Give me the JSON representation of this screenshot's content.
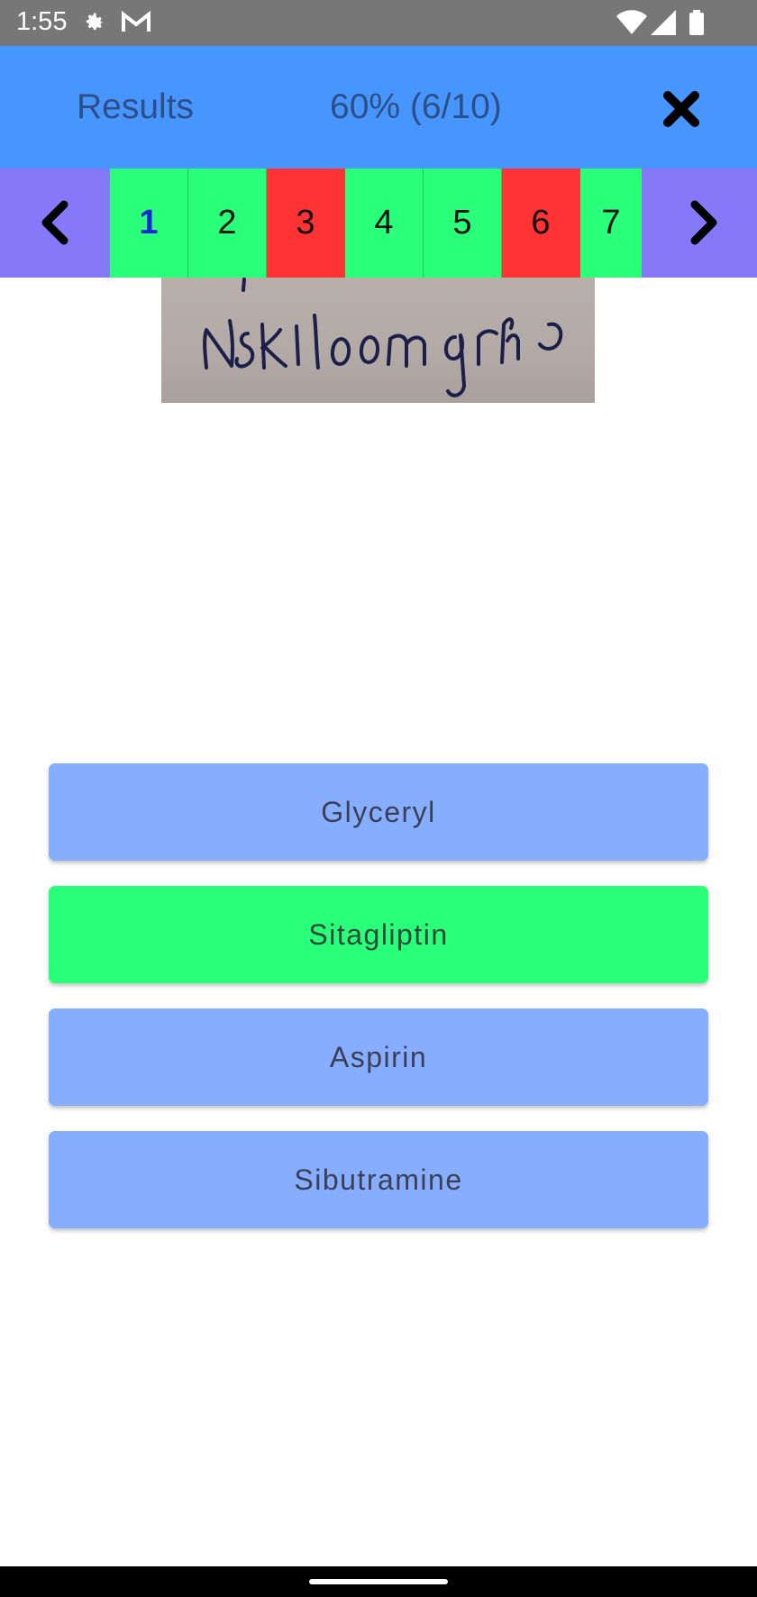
{
  "status_bar": {
    "time": "1:55",
    "icons": [
      "gear-icon",
      "gmail-icon",
      "wifi-icon",
      "signal-icon",
      "battery-icon"
    ]
  },
  "header": {
    "title": "Results",
    "score": "60% (6/10)",
    "close_icon": "close-icon"
  },
  "pager": {
    "prev_icon": "chevron-left-icon",
    "next_icon": "chevron-right-icon",
    "pages": [
      {
        "label": "1",
        "status": "correct",
        "current": true
      },
      {
        "label": "2",
        "status": "correct"
      },
      {
        "label": "3",
        "status": "wrong"
      },
      {
        "label": "4",
        "status": "correct"
      },
      {
        "label": "5",
        "status": "correct"
      },
      {
        "label": "6",
        "status": "wrong"
      },
      {
        "label": "7",
        "status": "correct"
      }
    ],
    "colors": {
      "correct": "#29FF78",
      "wrong": "#FF3333",
      "bar": "#8579F9"
    }
  },
  "question": {
    "image": "handwritten-prescription-image"
  },
  "answers": [
    {
      "label": "Glyceryl",
      "status": "neutral"
    },
    {
      "label": "Sitagliptin",
      "status": "correct"
    },
    {
      "label": "Aspirin",
      "status": "neutral"
    },
    {
      "label": "Sibutramine",
      "status": "neutral"
    }
  ],
  "colors": {
    "header": "#4796FF",
    "answer_default": "#87ADFF",
    "answer_correct": "#29FF78"
  }
}
